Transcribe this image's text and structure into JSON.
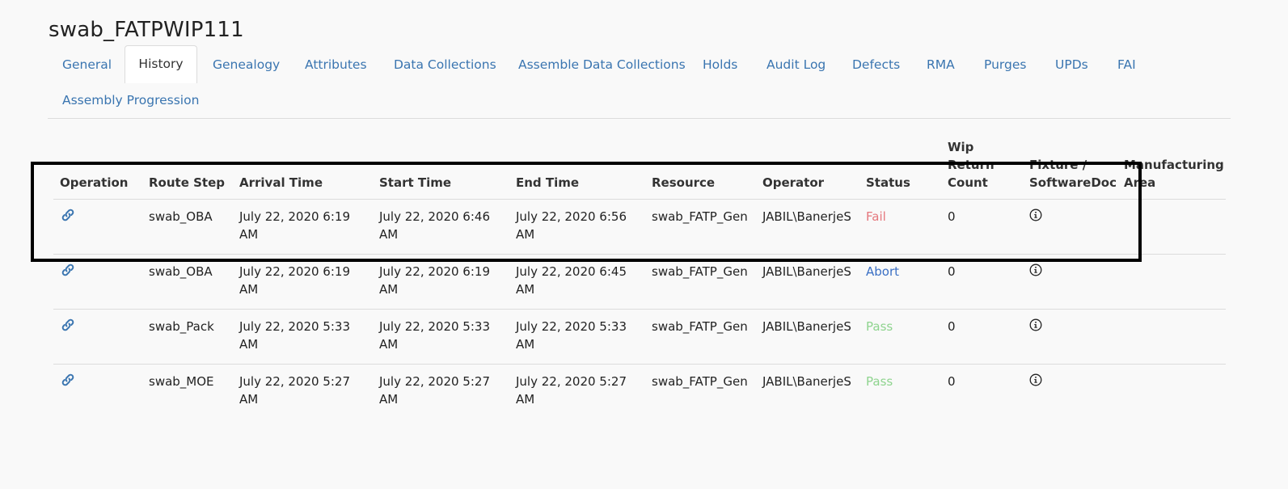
{
  "page_title": "swab_FATPWIP111",
  "tabs": [
    {
      "label": "General"
    },
    {
      "label": "History"
    },
    {
      "label": "Genealogy"
    },
    {
      "label": "Attributes"
    },
    {
      "label": "Data Collections"
    },
    {
      "label": "Assemble Data Collections"
    },
    {
      "label": "Holds"
    },
    {
      "label": "Audit Log"
    },
    {
      "label": "Defects"
    },
    {
      "label": "RMA"
    },
    {
      "label": "Purges"
    },
    {
      "label": "UPDs"
    },
    {
      "label": "FAI"
    },
    {
      "label": "Assembly Progression"
    }
  ],
  "active_tab": "History",
  "table": {
    "headers": {
      "operation": "Operation",
      "route_step": "Route Step",
      "arrival_time": "Arrival Time",
      "start_time": "Start Time",
      "end_time": "End Time",
      "resource": "Resource",
      "operator": "Operator",
      "status": "Status",
      "wip_return_1": "Wip",
      "wip_return_2": "Return",
      "wip_return_3": "Count",
      "fixture_1": "Fixture /",
      "fixture_2": "SoftwareDoc",
      "mfg_area_1": "Manufacturing",
      "mfg_area_2": "Area"
    },
    "rows": [
      {
        "route_step": "swab_OBA",
        "arrival_1": "July 22, 2020 6:19",
        "arrival_2": "AM",
        "start_1": "July 22, 2020 6:46",
        "start_2": "AM",
        "end_1": "July 22, 2020 6:56",
        "end_2": "AM",
        "resource": "swab_FATP_Gen",
        "operator": "JABIL\\BanerjeS",
        "status": "Fail",
        "wip_return_count": "0"
      },
      {
        "route_step": "swab_OBA",
        "arrival_1": "July 22, 2020 6:19",
        "arrival_2": "AM",
        "start_1": "July 22, 2020 6:19",
        "start_2": "AM",
        "end_1": "July 22, 2020 6:45",
        "end_2": "AM",
        "resource": "swab_FATP_Gen",
        "operator": "JABIL\\BanerjeS",
        "status": "Abort",
        "wip_return_count": "0"
      },
      {
        "route_step": "swab_Pack",
        "arrival_1": "July 22, 2020 5:33",
        "arrival_2": "AM",
        "start_1": "July 22, 2020 5:33",
        "start_2": "AM",
        "end_1": "July 22, 2020 5:33",
        "end_2": "AM",
        "resource": "swab_FATP_Gen",
        "operator": "JABIL\\BanerjeS",
        "status": "Pass",
        "wip_return_count": "0"
      },
      {
        "route_step": "swab_MOE",
        "arrival_1": "July 22, 2020 5:27",
        "arrival_2": "AM",
        "start_1": "July 22, 2020 5:27",
        "start_2": "AM",
        "end_1": "July 22, 2020 5:27",
        "end_2": "AM",
        "resource": "swab_FATP_Gen",
        "operator": "JABIL\\BanerjeS",
        "status": "Pass",
        "wip_return_count": "0"
      }
    ]
  },
  "colors": {
    "link": "#3a75b0",
    "fail": "#e5777d",
    "abort": "#3a6fc4",
    "pass": "#8fd48f",
    "highlight_border": "#000000"
  },
  "icons": {
    "operation": "link-icon",
    "fixture": "info-icon"
  }
}
